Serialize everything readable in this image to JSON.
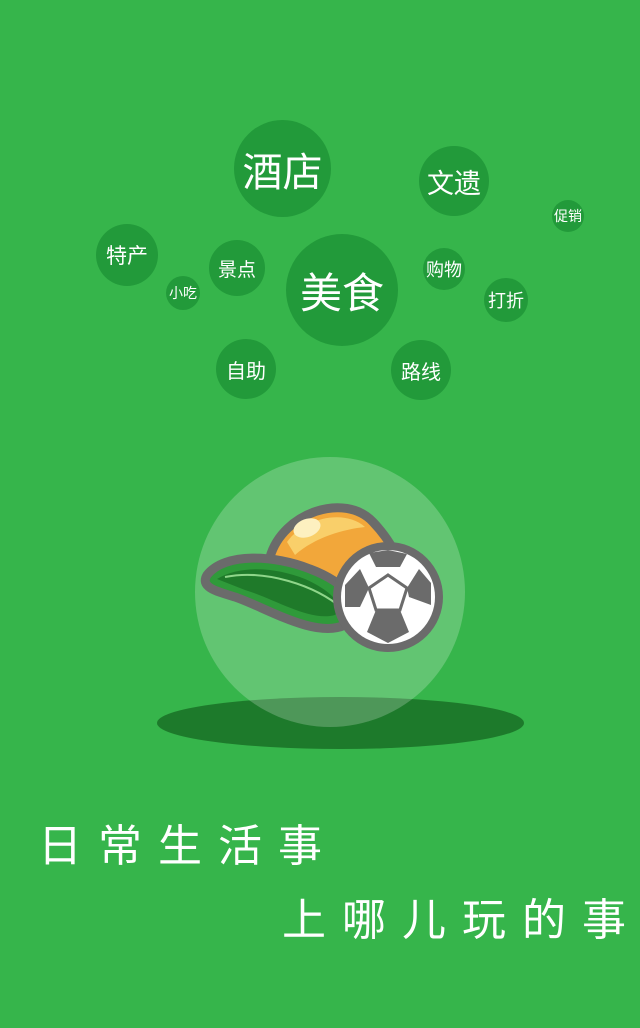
{
  "tag_cloud": {
    "jiudian": "酒店",
    "wenyi": "文遗",
    "cuxiao": "促销",
    "techan": "特产",
    "jingdian": "景点",
    "meishi": "美食",
    "gouwu": "购物",
    "xiaochi": "小吃",
    "dazhe": "打折",
    "zizhu": "自助",
    "luxian": "路线"
  },
  "logo": {
    "icon": "cap-with-soccer-ball-icon"
  },
  "slogan": {
    "line1": "日常生活事",
    "line2": "上哪儿玩的事"
  },
  "colors": {
    "background": "#36b54b",
    "bubble": "#229a3a",
    "shadow": "#1d7a2b"
  }
}
